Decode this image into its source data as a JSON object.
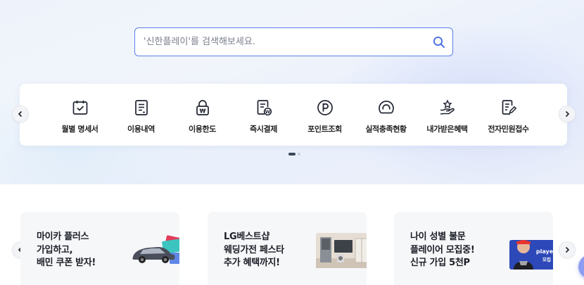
{
  "search": {
    "placeholder": "'신한플레이'를 검색해보세요."
  },
  "quick_menu": {
    "items": [
      {
        "label": "월별 명세서",
        "icon": "calendar-check-icon"
      },
      {
        "label": "이용내역",
        "icon": "receipt-list-icon"
      },
      {
        "label": "이용한도",
        "icon": "lock-won-icon"
      },
      {
        "label": "즉시결제",
        "icon": "document-won-icon"
      },
      {
        "label": "포인트조회",
        "icon": "point-p-icon"
      },
      {
        "label": "실적충족현황",
        "icon": "gauge-icon"
      },
      {
        "label": "내가받은혜택",
        "icon": "hand-star-icon"
      },
      {
        "label": "전자민원접수",
        "icon": "document-pen-icon"
      }
    ],
    "page_indicator": {
      "total": 2,
      "current": 1
    }
  },
  "banners": [
    {
      "text": "마이카 플러스\n가입하고,\n배민 쿠폰 받자!",
      "image": "car-coupons-illustration"
    },
    {
      "text": "LG베스트샵\n웨딩가전 페스타\n추가 혜택까지!",
      "image": "home-appliances-illustration"
    },
    {
      "text": "나이 성별 불문\n플레이어 모집중!\n신규 가입 5천P",
      "image": "player-recruit-illustration",
      "image_text": [
        "player",
        "모집"
      ]
    }
  ],
  "colors": {
    "accent": "#5b7ee8",
    "icon_stroke": "#1f2330",
    "banner_bg": "#f6f7f9"
  }
}
